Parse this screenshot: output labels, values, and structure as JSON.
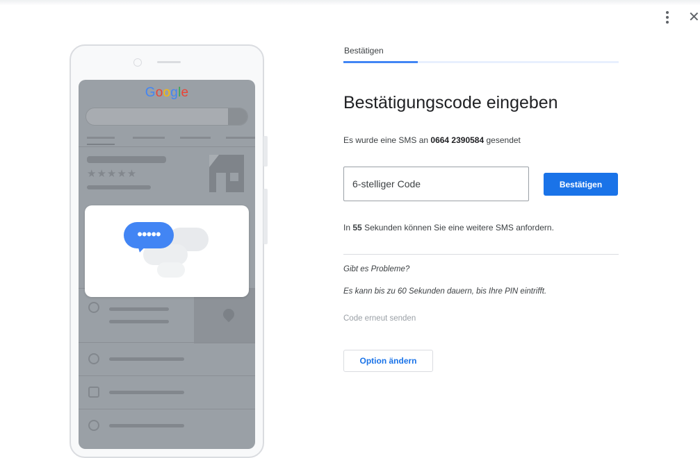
{
  "window": {
    "more_icon": "more-vert-icon",
    "close_icon": "close-icon",
    "close_glyph": "✕"
  },
  "illustration": {
    "logo": "Google",
    "logo_colors": [
      "#4285f4",
      "#ea4335",
      "#fbbc05",
      "#4285f4",
      "#34a853",
      "#ea4335"
    ],
    "stars": "★★★★★",
    "chat_dots": "•••••"
  },
  "stepper": {
    "label": "Bestätigen",
    "progress_fraction": 0.27,
    "accent": "#4285f4"
  },
  "main": {
    "heading": "Bestätigungscode eingeben",
    "sms_prefix": "Es wurde eine SMS an",
    "phone_number": "0664 2390584",
    "sms_suffix": "gesendet",
    "code_input": {
      "placeholder": "6-stelliger Code",
      "value": ""
    },
    "confirm_button": "Bestätigen",
    "countdown_prefix": "In",
    "countdown_seconds": "55",
    "countdown_suffix": "Sekunden können Sie eine weitere SMS anfordern.",
    "problems": "Gibt es Probleme?",
    "delay_note": "Es kann bis zu 60 Sekunden dauern, bis Ihre PIN eintrifft.",
    "resend_link": "Code erneut senden",
    "change_option_button": "Option ändern"
  },
  "colors": {
    "primary": "#1a73e8",
    "text": "#202124",
    "muted": "#9aa0a6"
  }
}
